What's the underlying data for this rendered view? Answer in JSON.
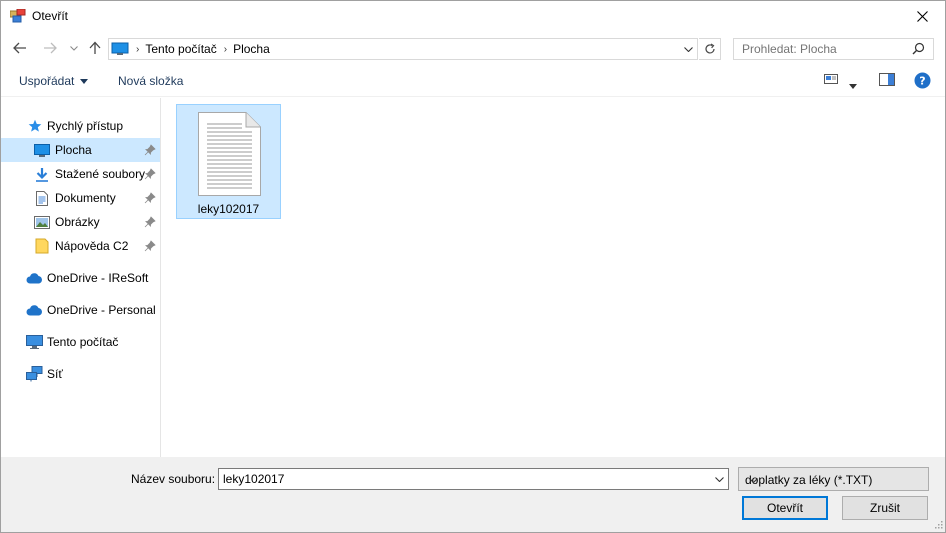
{
  "window": {
    "title": "Otevřít"
  },
  "address": {
    "breadcrumb": [
      "Tento počítač",
      "Plocha"
    ]
  },
  "search": {
    "placeholder": "Prohledat: Plocha"
  },
  "toolbar": {
    "organize_label": "Uspořádat",
    "new_folder_label": "Nová složka"
  },
  "navigation": {
    "quick_access": "Rychlý přístup",
    "items": [
      {
        "label": "Plocha"
      },
      {
        "label": "Stažené soubory"
      },
      {
        "label": "Dokumenty"
      },
      {
        "label": "Obrázky"
      },
      {
        "label": "Nápověda C2"
      }
    ],
    "onedrive_iresoft": "OneDrive - IReSoft",
    "onedrive_personal": "OneDrive - Personal",
    "this_pc": "Tento počítač",
    "network": "Síť"
  },
  "files": [
    {
      "name": "leky102017"
    }
  ],
  "bottom": {
    "filename_label": "Název souboru:",
    "filename_value": "leky102017",
    "filter_value": "doplatky za léky (*.TXT)",
    "open_label": "Otevřít",
    "cancel_label": "Zrušit"
  },
  "colors": {
    "selection": "#cce8ff",
    "accent": "#0078d7",
    "folder": "#ffd75e"
  }
}
